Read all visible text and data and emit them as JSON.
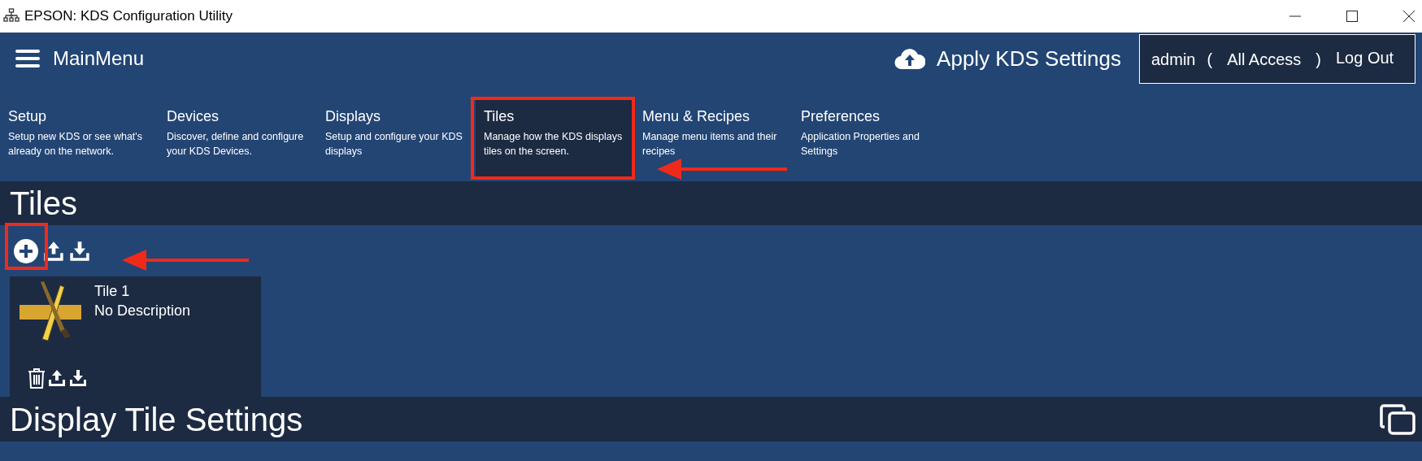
{
  "window": {
    "title": "EPSON: KDS Configuration Utility"
  },
  "header": {
    "menu_label": "MainMenu",
    "apply_label": "Apply KDS Settings",
    "user": {
      "name": "admin",
      "open_paren": "(",
      "access": "All Access",
      "close_paren": ")",
      "logout": "Log Out"
    }
  },
  "nav": [
    {
      "title": "Setup",
      "description": "Setup new KDS or see what's already on the network.",
      "selected": false
    },
    {
      "title": "Devices",
      "description": "Discover, define and configure your KDS Devices.",
      "selected": false
    },
    {
      "title": "Displays",
      "description": "Setup and configure your KDS displays",
      "selected": false
    },
    {
      "title": "Tiles",
      "description": "Manage how the KDS displays tiles on the screen.",
      "selected": true
    },
    {
      "title": "Menu & Recipes",
      "description": "Manage menu items and their recipes",
      "selected": false
    },
    {
      "title": "Preferences",
      "description": "Application Properties and Settings",
      "selected": false
    }
  ],
  "tiles_section": {
    "heading": "Tiles",
    "tiles": [
      {
        "name": "Tile 1",
        "description": "No Description"
      }
    ]
  },
  "settings_section": {
    "heading": "Display Tile Settings"
  }
}
